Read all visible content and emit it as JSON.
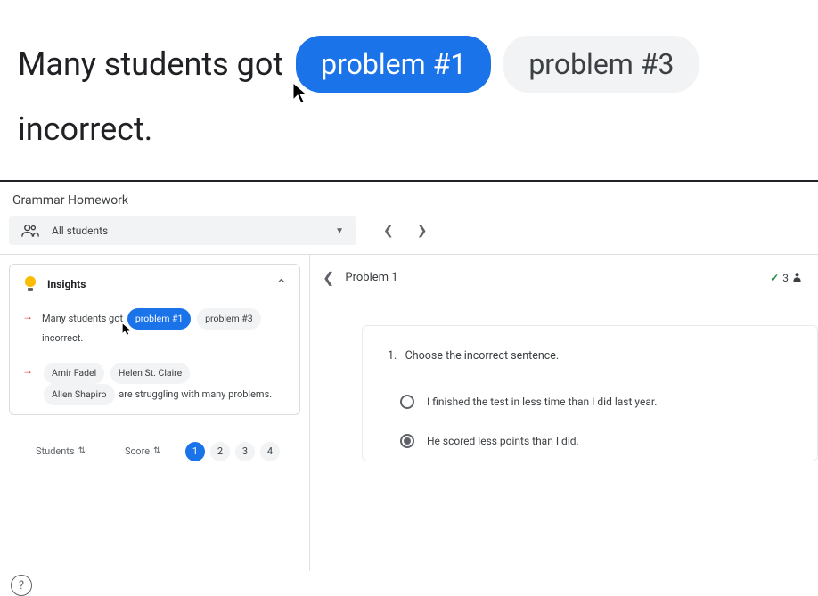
{
  "hero": {
    "prefix": "Many students got",
    "chip_active": "problem #1",
    "chip_inactive": "problem #3",
    "suffix": "incorrect."
  },
  "app": {
    "title": "Grammar Homework",
    "student_select_label": "All students"
  },
  "insights": {
    "title": "Insights",
    "items": [
      {
        "prefix": "Many students got",
        "chip_active": "problem #1",
        "chip_inactive": "problem #3",
        "suffix": "incorrect."
      },
      {
        "names": [
          "Amir Fadel",
          "Helen St. Claire",
          "Allen Shapiro"
        ],
        "suffix": "are struggling with many problems."
      }
    ]
  },
  "table": {
    "col_students": "Students",
    "col_score": "Score",
    "pages": [
      "1",
      "2",
      "3",
      "4"
    ],
    "active_page": 0
  },
  "problem": {
    "title": "Problem 1",
    "stat_count": "3",
    "question_num": "1.",
    "question_text": "Choose the incorrect sentence.",
    "options": [
      {
        "text": "I finished the test in less time than I did last year.",
        "selected": false
      },
      {
        "text": "He scored less points than I did.",
        "selected": true
      }
    ]
  },
  "help_label": "?"
}
